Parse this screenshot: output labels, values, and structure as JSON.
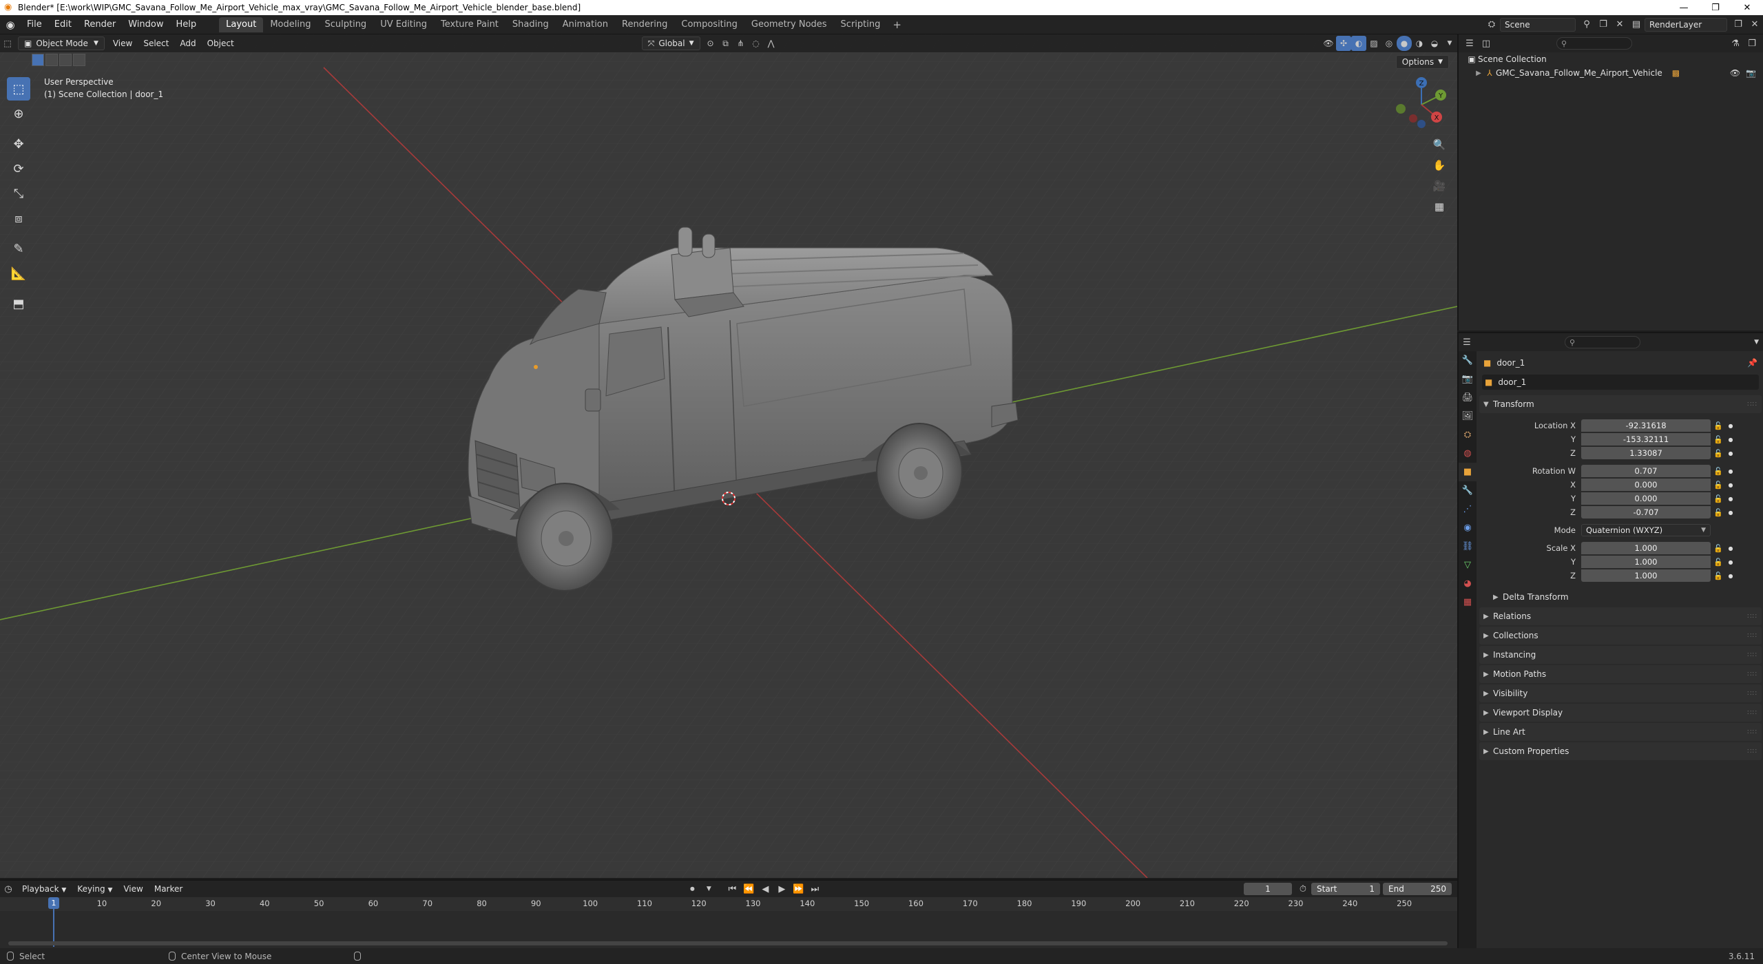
{
  "window": {
    "title": "Blender* [E:\\work\\WIP\\GMC_Savana_Follow_Me_Airport_Vehicle_max_vray\\GMC_Savana_Follow_Me_Airport_Vehicle_blender_base.blend]",
    "min_glyph": "—",
    "max_glyph": "❐",
    "close_glyph": "✕"
  },
  "menu": [
    "File",
    "Edit",
    "Render",
    "Window",
    "Help"
  ],
  "workspaces": [
    "Layout",
    "Modeling",
    "Sculpting",
    "UV Editing",
    "Texture Paint",
    "Shading",
    "Animation",
    "Rendering",
    "Compositing",
    "Geometry Nodes",
    "Scripting"
  ],
  "workspace_add": "+",
  "scene": {
    "name": "Scene",
    "render_layer": "RenderLayer"
  },
  "viewport": {
    "mode": "Object Mode",
    "menus": [
      "View",
      "Select",
      "Add",
      "Object"
    ],
    "transform_orientation": "Global",
    "options_label": "Options",
    "perspective_label": "User Perspective",
    "collection_label": "(1) Scene Collection | door_1",
    "gizmo": {
      "x": "X",
      "y": "Y",
      "z": "Z"
    },
    "axis_colors": {
      "x": "#a83a3a",
      "y": "#6e9a33",
      "z": "#3c6fb5"
    }
  },
  "outliner": {
    "root": "Scene Collection",
    "items": [
      {
        "name": "GMC_Savana_Follow_Me_Airport_Vehicle"
      }
    ]
  },
  "properties": {
    "object_name": "door_1",
    "object_datablock": "door_1",
    "transform_label": "Transform",
    "location": {
      "label_x": "Location X",
      "label_y": "Y",
      "label_z": "Z",
      "x": "-92.31618",
      "y": "-153.32111",
      "z": "1.33087"
    },
    "rotation": {
      "label_w": "Rotation W",
      "label_x": "X",
      "label_y": "Y",
      "label_z": "Z",
      "w": "0.707",
      "x": "0.000",
      "y": "0.000",
      "z": "-0.707"
    },
    "mode": {
      "label": "Mode",
      "value": "Quaternion (WXYZ)"
    },
    "scale": {
      "label_x": "Scale X",
      "label_y": "Y",
      "label_z": "Z",
      "x": "1.000",
      "y": "1.000",
      "z": "1.000"
    },
    "delta_transform": "Delta Transform",
    "panels": [
      "Relations",
      "Collections",
      "Instancing",
      "Motion Paths",
      "Visibility",
      "Viewport Display",
      "Line Art",
      "Custom Properties"
    ]
  },
  "timeline": {
    "menus": [
      "Playback",
      "Keying",
      "View",
      "Marker"
    ],
    "current_frame": "1",
    "start_label": "Start",
    "start": "1",
    "end_label": "End",
    "end": "250",
    "ticks": [
      "10",
      "20",
      "30",
      "40",
      "50",
      "60",
      "70",
      "80",
      "90",
      "100",
      "110",
      "120",
      "130",
      "140",
      "150",
      "160",
      "170",
      "180",
      "190",
      "200",
      "210",
      "220",
      "230",
      "240",
      "250"
    ]
  },
  "status": {
    "select": "Select",
    "center_view": "Center View to Mouse",
    "version": "3.6.11"
  }
}
